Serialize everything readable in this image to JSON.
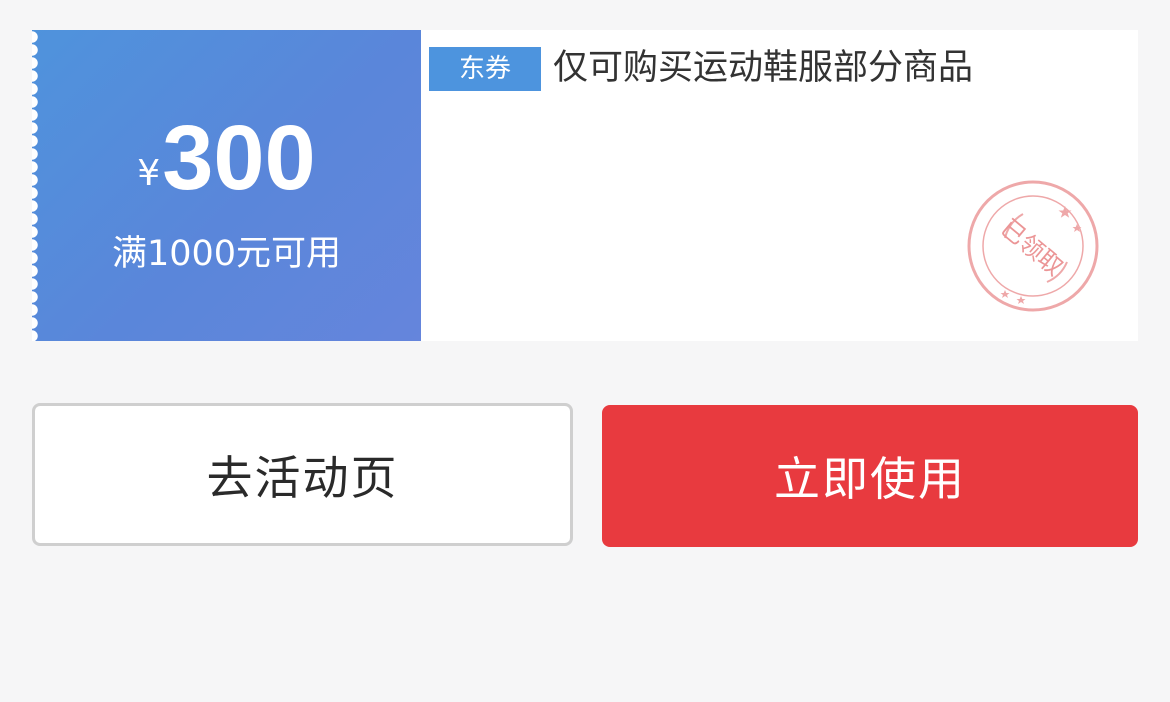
{
  "coupon": {
    "currency_symbol": "¥",
    "amount": "300",
    "condition": "满1000元可用",
    "tag_label": "东券",
    "description": "仅可购买运动鞋服部分商品",
    "stamp_text": "已领取",
    "colors": {
      "left_gradient_start": "#4f93dc",
      "left_gradient_end": "#6585dc",
      "tag_bg": "#4d94de",
      "stamp": "#e8888a"
    }
  },
  "actions": {
    "activity_label": "去活动页",
    "use_label": "立即使用",
    "colors": {
      "use_bg": "#e83a3f",
      "activity_border": "#cfcfcf"
    }
  }
}
